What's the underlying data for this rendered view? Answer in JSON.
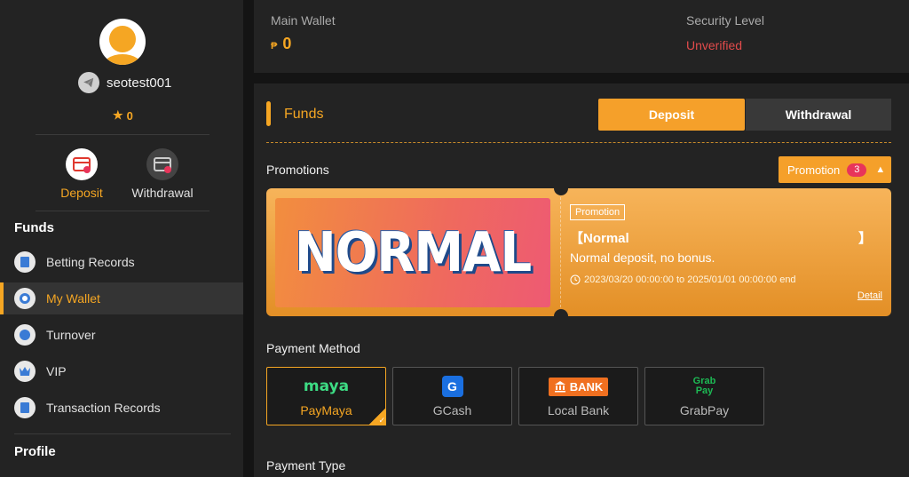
{
  "sidebar": {
    "username": "seotest001",
    "points": "0",
    "quick": [
      {
        "label": "Deposit"
      },
      {
        "label": "Withdrawal"
      }
    ],
    "funds_title": "Funds",
    "menu": [
      {
        "label": "Betting Records"
      },
      {
        "label": "My Wallet"
      },
      {
        "label": "Turnover"
      },
      {
        "label": "VIP"
      },
      {
        "label": "Transaction Records"
      }
    ],
    "profile_title": "Profile"
  },
  "wallet": {
    "main_label": "Main Wallet",
    "currency": "₱",
    "amount": "0",
    "security_label": "Security Level",
    "security_value": "Unverified"
  },
  "main": {
    "title": "Funds",
    "tabs": [
      "Deposit",
      "Withdrawal"
    ],
    "promotions_label": "Promotions",
    "promotion_button": "Promotion",
    "promotion_count": "3",
    "promo": {
      "banner_text": "NORMAL",
      "tag": "Promotion",
      "title_open": "【Normal",
      "title_close": "】",
      "description": "Normal deposit, no bonus.",
      "period": "2023/03/20 00:00:00 to 2025/01/01 00:00:00 end",
      "detail": "Detail"
    },
    "payment_method_label": "Payment Method",
    "payment_methods": [
      {
        "label": "PayMaya",
        "logo_text": "maya",
        "selected": true
      },
      {
        "label": "GCash",
        "logo_text": "G"
      },
      {
        "label": "Local Bank",
        "logo_text": "BANK"
      },
      {
        "label": "GrabPay",
        "logo_text": "Grab Pay"
      }
    ],
    "payment_type_label": "Payment Type"
  },
  "colors": {
    "accent": "#f5a623",
    "danger": "#e24b4b",
    "background": "#141414",
    "panel": "#232323"
  }
}
